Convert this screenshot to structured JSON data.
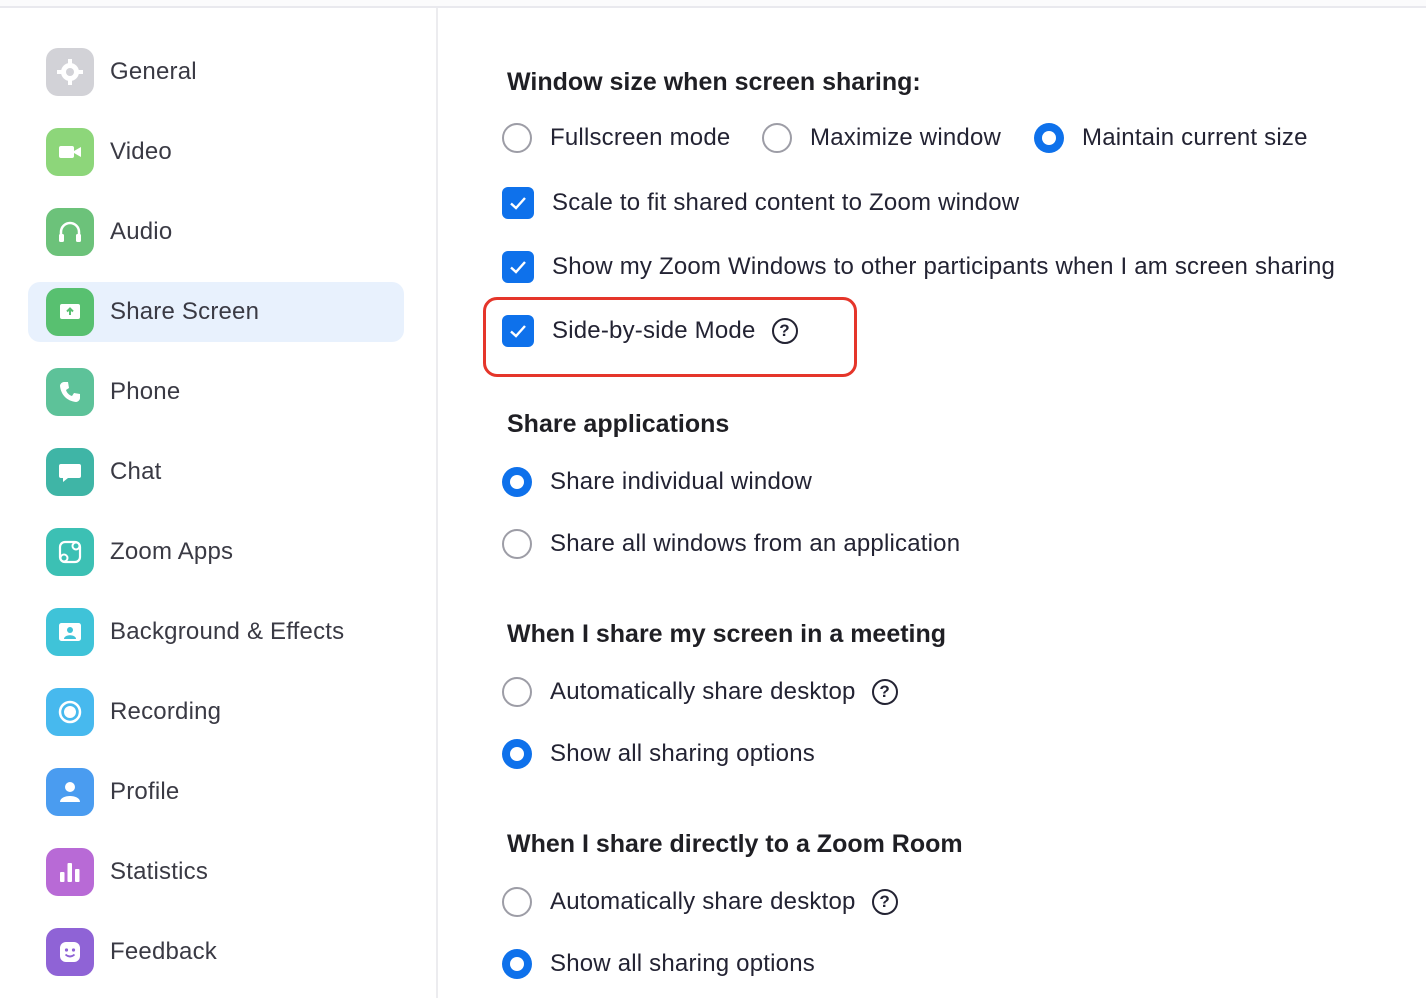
{
  "sidebar": {
    "items": [
      {
        "label": "General",
        "icon": "gear-icon",
        "color": "#c9c9cf"
      },
      {
        "label": "Video",
        "icon": "video-camera-icon",
        "color": "#8dd67a"
      },
      {
        "label": "Audio",
        "icon": "headphones-icon",
        "color": "#6cc27a"
      },
      {
        "label": "Share Screen",
        "icon": "share-screen-icon",
        "color": "#58c070",
        "active": true
      },
      {
        "label": "Phone",
        "icon": "phone-icon",
        "color": "#5dc299"
      },
      {
        "label": "Chat",
        "icon": "chat-bubble-icon",
        "color": "#3fb5a6"
      },
      {
        "label": "Zoom Apps",
        "icon": "zoom-apps-icon",
        "color": "#3cc0b4"
      },
      {
        "label": "Background & Effects",
        "icon": "background-icon",
        "color": "#3fc3d8"
      },
      {
        "label": "Recording",
        "icon": "recording-icon",
        "color": "#47b9ee"
      },
      {
        "label": "Profile",
        "icon": "profile-icon",
        "color": "#4a9cf0"
      },
      {
        "label": "Statistics",
        "icon": "statistics-icon",
        "color": "#b86ad6"
      },
      {
        "label": "Feedback",
        "icon": "feedback-icon",
        "color": "#8f63d6"
      }
    ]
  },
  "window_size": {
    "title": "Window size when screen sharing:",
    "options": [
      "Fullscreen mode",
      "Maximize window",
      "Maintain current size"
    ],
    "selected": "Maintain current size"
  },
  "checkboxes": {
    "scale_to_fit": "Scale to fit shared content to Zoom window",
    "show_zoom_windows": "Show my Zoom Windows to other participants when I am screen sharing",
    "side_by_side": "Side-by-side Mode"
  },
  "share_applications": {
    "title": "Share applications",
    "options": [
      "Share individual window",
      "Share all windows from an application"
    ],
    "selected": "Share individual window"
  },
  "share_in_meeting": {
    "title": "When I share my screen in a meeting",
    "options": [
      "Automatically share desktop",
      "Show all sharing options"
    ],
    "selected": "Show all sharing options"
  },
  "share_to_zoom_room": {
    "title": "When I share directly to a Zoom Room",
    "options": [
      "Automatically share desktop",
      "Show all sharing options"
    ],
    "selected": "Show all sharing options"
  },
  "help_glyph": "?",
  "accent_color": "#0e71eb",
  "highlight_color": "#e5352a"
}
